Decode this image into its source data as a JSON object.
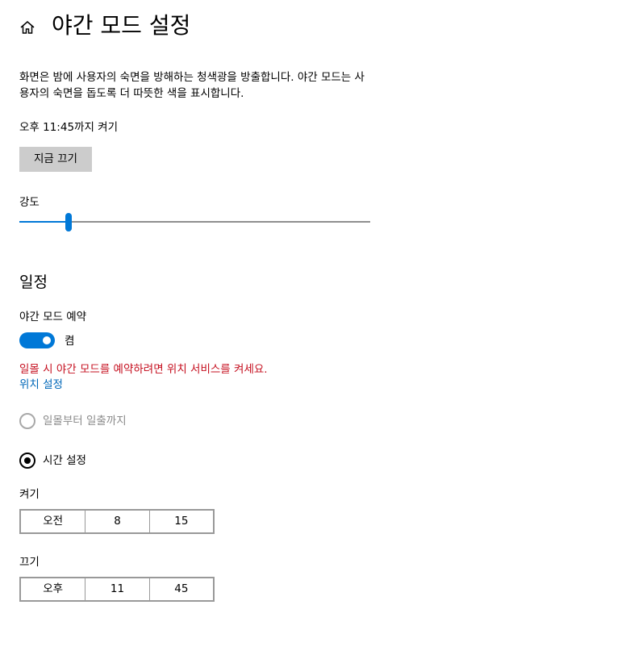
{
  "header": {
    "title": "야간 모드 설정",
    "home_icon": "home-icon"
  },
  "description": "화면은 밤에 사용자의 숙면을 방해하는 청색광을 방출합니다. 야간 모드는 사용자의 숙면을 돕도록 더 따뜻한 색을 표시합니다.",
  "status": "오후 11:45까지 켜기",
  "turn_off_button": "지금 끄기",
  "strength": {
    "label": "강도",
    "value_fraction": 0.14
  },
  "schedule": {
    "section_title": "일정",
    "toggle_label": "야간 모드 예약",
    "toggle_state": "켬",
    "toggle_on": true,
    "warning": "일몰 시 야간 모드를 예약하려면 위치 서비스를 켜세요.",
    "location_link": "위치 설정",
    "option_sunset": "일몰부터 일출까지",
    "option_custom": "시간 설정",
    "selected": "custom"
  },
  "turn_on": {
    "label": "켜기",
    "ampm": "오전",
    "hour": "8",
    "minute": "15"
  },
  "turn_off": {
    "label": "끄기",
    "ampm": "오후",
    "hour": "11",
    "minute": "45"
  },
  "colors": {
    "accent": "#0078d7",
    "warning": "#c50f1f",
    "link": "#0067b8",
    "button_bg": "#cccccc",
    "disabled_text": "#8a8a8a"
  }
}
